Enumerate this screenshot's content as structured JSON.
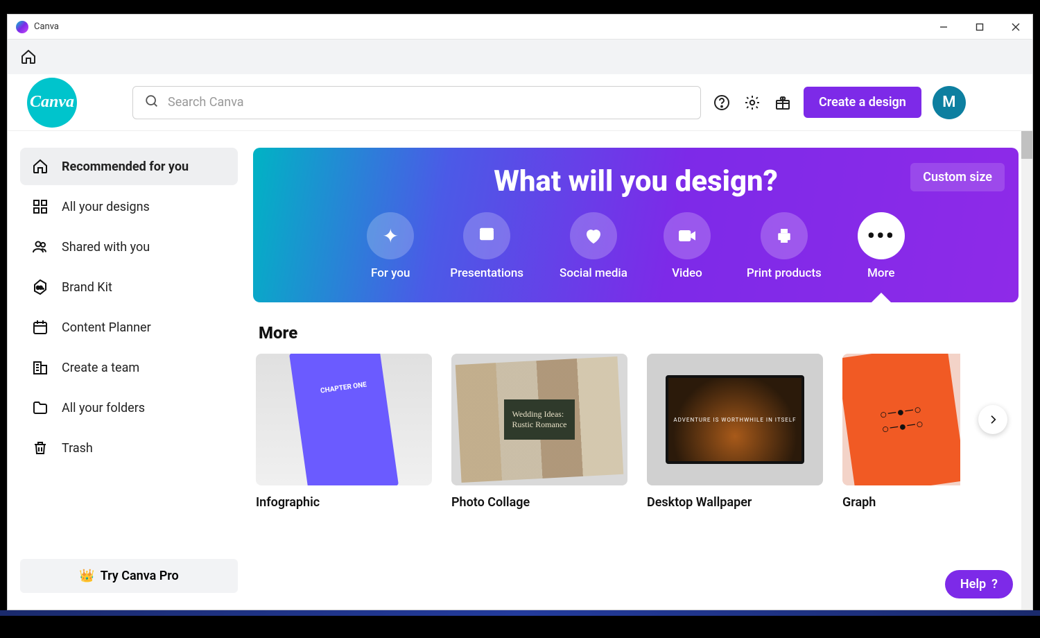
{
  "window": {
    "title": "Canva"
  },
  "logo_text": "Canva",
  "search": {
    "placeholder": "Search Canva"
  },
  "create_button": "Create a design",
  "avatar_initial": "M",
  "sidebar": {
    "items": [
      {
        "label": "Recommended for you"
      },
      {
        "label": "All your designs"
      },
      {
        "label": "Shared with you"
      },
      {
        "label": "Brand Kit"
      },
      {
        "label": "Content Planner"
      },
      {
        "label": "Create a team"
      },
      {
        "label": "All your folders"
      },
      {
        "label": "Trash"
      }
    ],
    "pro_button": "Try Canva Pro"
  },
  "hero": {
    "title": "What will you design?",
    "custom_size": "Custom size",
    "categories": [
      {
        "label": "For you"
      },
      {
        "label": "Presentations"
      },
      {
        "label": "Social media"
      },
      {
        "label": "Video"
      },
      {
        "label": "Print products"
      },
      {
        "label": "More"
      }
    ]
  },
  "section": {
    "title": "More",
    "cards": [
      {
        "label": "Infographic"
      },
      {
        "label": "Photo Collage"
      },
      {
        "label": "Desktop Wallpaper"
      },
      {
        "label": "Graph"
      }
    ]
  },
  "help_button": "Help",
  "inline": {
    "wallpaper_text": "ADVENTURE IS WORTHWHILE\nIN ITSELF"
  }
}
